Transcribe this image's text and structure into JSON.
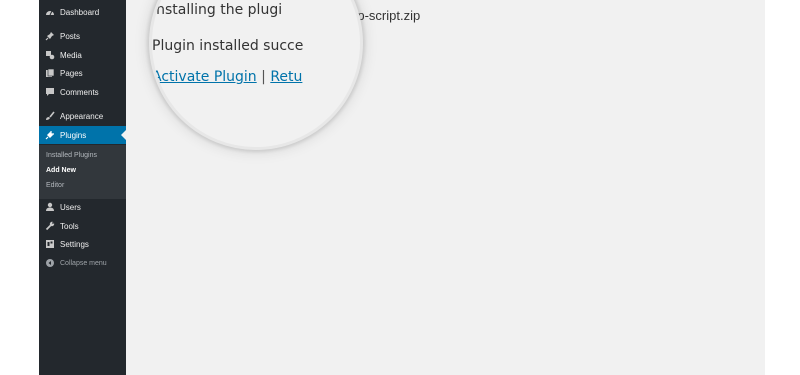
{
  "sidebar": {
    "items": [
      {
        "label": "Dashboard",
        "icon": "dashboard-icon"
      },
      {
        "label": "Posts",
        "icon": "pin-icon"
      },
      {
        "label": "Media",
        "icon": "media-icon"
      },
      {
        "label": "Pages",
        "icon": "pages-icon"
      },
      {
        "label": "Comments",
        "icon": "comment-icon"
      },
      {
        "label": "Appearance",
        "icon": "brush-icon"
      },
      {
        "label": "Plugins",
        "icon": "plugin-icon"
      },
      {
        "label": "Users",
        "icon": "user-icon"
      },
      {
        "label": "Tools",
        "icon": "wrench-icon"
      },
      {
        "label": "Settings",
        "icon": "settings-icon"
      }
    ],
    "submenu": [
      "Installed Plugins",
      "Add New",
      "Editor"
    ],
    "collapse_label": "Collapse menu"
  },
  "main": {
    "status_line_tail": "uploaded file: wp-script.zip"
  },
  "magnifier": {
    "installing_text": "Installing the plugi",
    "success_text": "Plugin installed succe",
    "activate_link": "Activate Plugin",
    "separator": "|",
    "return_link": "Retu"
  },
  "colors": {
    "sidebar_bg": "#23282d",
    "active": "#0073aa",
    "link": "#0073aa",
    "content_bg": "#f1f1f1"
  }
}
